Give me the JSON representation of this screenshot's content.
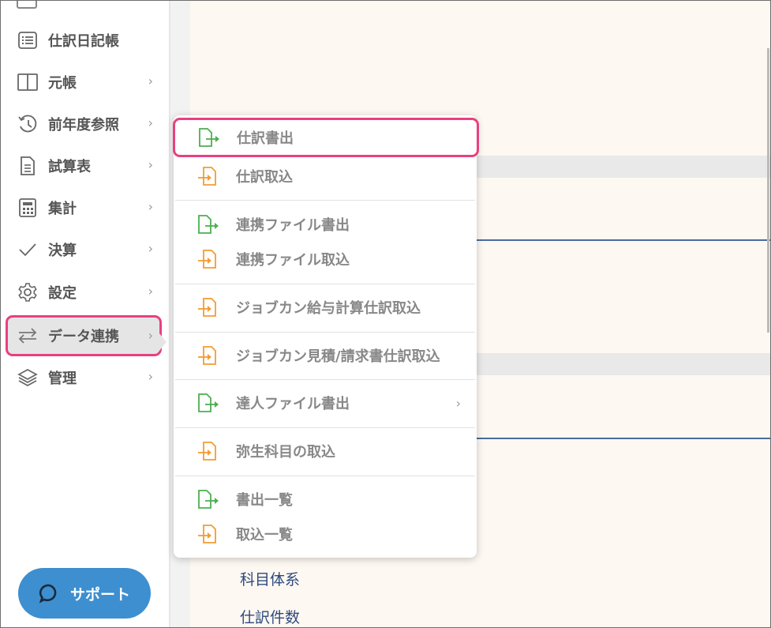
{
  "sidebar": {
    "items": [
      {
        "label": "仕訳日記帳",
        "icon": "list-icon",
        "chevron": ""
      },
      {
        "label": "元帳",
        "icon": "columns-icon",
        "chevron": "›"
      },
      {
        "label": "前年度参照",
        "icon": "history-icon",
        "chevron": "›"
      },
      {
        "label": "試算表",
        "icon": "document-icon",
        "chevron": "›"
      },
      {
        "label": "集計",
        "icon": "calculator-icon",
        "chevron": "›"
      },
      {
        "label": "決算",
        "icon": "check-icon",
        "chevron": "›"
      },
      {
        "label": "設定",
        "icon": "gear-icon",
        "chevron": "›"
      },
      {
        "label": "データ連携",
        "icon": "arrows-swap-icon",
        "chevron": "›"
      },
      {
        "label": "管理",
        "icon": "layers-icon",
        "chevron": "›"
      }
    ],
    "active_item": "データ連携"
  },
  "support": {
    "label": "サポート",
    "icon": "chat-bubble-icon"
  },
  "content": {
    "links": [
      "科目体系",
      "仕訳件数"
    ]
  },
  "flyout": {
    "items": [
      {
        "label": "仕訳書出",
        "icon": "file-export-icon",
        "color": "#4caf50",
        "chevron": ""
      },
      {
        "label": "仕訳取込",
        "icon": "file-import-icon",
        "color": "#f39c33",
        "chevron": ""
      },
      {
        "label": "連携ファイル書出",
        "icon": "file-export-icon",
        "color": "#4caf50",
        "chevron": ""
      },
      {
        "label": "連携ファイル取込",
        "icon": "file-import-icon",
        "color": "#f39c33",
        "chevron": ""
      },
      {
        "label": "ジョブカン給与計算仕訳取込",
        "icon": "file-import-icon",
        "color": "#f39c33",
        "chevron": ""
      },
      {
        "label": "ジョブカン見積/請求書仕訳取込",
        "icon": "file-import-icon",
        "color": "#f39c33",
        "chevron": ""
      },
      {
        "label": "達人ファイル書出",
        "icon": "file-export-icon",
        "color": "#4caf50",
        "chevron": "›"
      },
      {
        "label": "弥生科目の取込",
        "icon": "file-import-icon",
        "color": "#f39c33",
        "chevron": ""
      },
      {
        "label": "書出一覧",
        "icon": "file-export-icon",
        "color": "#4caf50",
        "chevron": ""
      },
      {
        "label": "取込一覧",
        "icon": "file-import-icon",
        "color": "#f39c33",
        "chevron": ""
      }
    ],
    "highlighted_item": "仕訳書出"
  },
  "colors": {
    "highlight_border": "#e8407f",
    "export_green": "#4caf50",
    "import_orange": "#f39c33",
    "support_blue": "#3d8fd0",
    "content_bg": "#fdf8f2"
  }
}
